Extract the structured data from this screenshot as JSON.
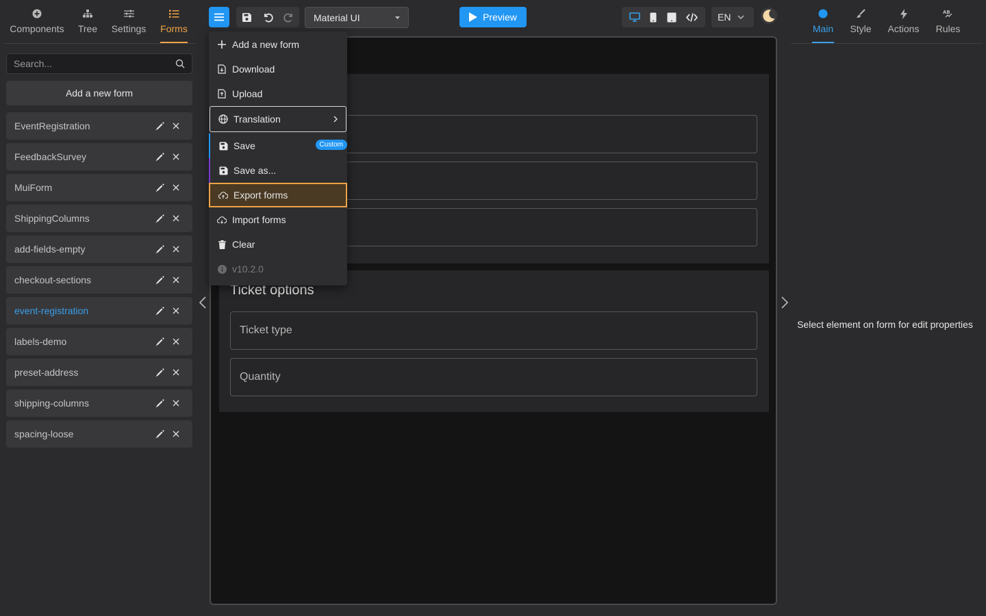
{
  "left_tabs": [
    {
      "label": "Components",
      "icon": "plus-circle-icon"
    },
    {
      "label": "Tree",
      "icon": "tree-icon"
    },
    {
      "label": "Settings",
      "icon": "sliders-icon"
    },
    {
      "label": "Forms",
      "icon": "list-icon",
      "active": true
    }
  ],
  "search": {
    "placeholder": "Search..."
  },
  "add_form_label": "Add a new form",
  "forms": [
    {
      "name": "EventRegistration"
    },
    {
      "name": "FeedbackSurvey"
    },
    {
      "name": "MuiForm"
    },
    {
      "name": "ShippingColumns"
    },
    {
      "name": "add-fields-empty"
    },
    {
      "name": "checkout-sections"
    },
    {
      "name": "event-registration",
      "active": true
    },
    {
      "name": "labels-demo"
    },
    {
      "name": "preset-address"
    },
    {
      "name": "shipping-columns"
    },
    {
      "name": "spacing-loose"
    }
  ],
  "toolbar": {
    "theme_select": "Material UI",
    "preview_label": "Preview",
    "language": "EN"
  },
  "menu": {
    "items": [
      {
        "label": "Add a new form",
        "icon": "plus-icon"
      },
      {
        "label": "Download",
        "icon": "download-file-icon"
      },
      {
        "label": "Upload",
        "icon": "upload-file-icon"
      },
      {
        "label": "Translation",
        "icon": "globe-icon"
      },
      {
        "label": "Save",
        "icon": "save-icon",
        "badge": "Custom"
      },
      {
        "label": "Save as...",
        "icon": "save-icon"
      },
      {
        "label": "Export forms",
        "icon": "cloud-upload-icon"
      },
      {
        "label": "Import forms",
        "icon": "cloud-download-icon"
      },
      {
        "label": "Clear",
        "icon": "trash-icon"
      },
      {
        "label": "v10.2.0",
        "icon": "info-icon"
      }
    ]
  },
  "canvas": {
    "section2_title": "Ticket options",
    "ticket_type_label": "Ticket type",
    "quantity_label": "Quantity"
  },
  "right_tabs": [
    {
      "label": "Main",
      "icon": "circle-icon",
      "active": true
    },
    {
      "label": "Style",
      "icon": "brush-icon"
    },
    {
      "label": "Actions",
      "icon": "lightning-icon"
    },
    {
      "label": "Rules",
      "icon": "rules-icon"
    }
  ],
  "properties_hint": "Select element on form for edit properties",
  "colors": {
    "accent_blue": "#2196f3",
    "accent_orange": "#f0a345",
    "background": "#2b2b2d",
    "canvas": "#141414"
  }
}
